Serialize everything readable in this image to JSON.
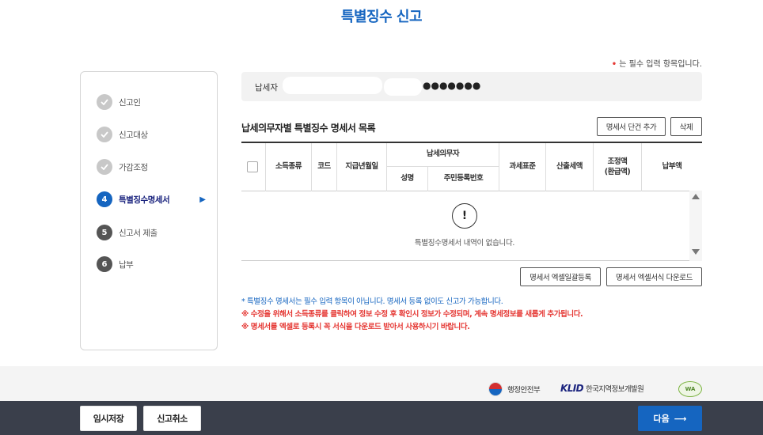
{
  "page": {
    "title": "특별징수 신고"
  },
  "required_note": {
    "marker": "•",
    "text": "는 필수 입력 항목입니다."
  },
  "steps": [
    {
      "label": "신고인",
      "status": "done",
      "number": ""
    },
    {
      "label": "신고대상",
      "status": "done",
      "number": ""
    },
    {
      "label": "가감조정",
      "status": "done",
      "number": ""
    },
    {
      "label": "특별징수명세서",
      "status": "active",
      "number": "4"
    },
    {
      "label": "신고서 제출",
      "status": "todo",
      "number": "5"
    },
    {
      "label": "납부",
      "status": "todo",
      "number": "6"
    }
  ],
  "taxpayer": {
    "label": "납세자",
    "masked_suffix": "●●●●●●●"
  },
  "list": {
    "title": "납세의무자별 특별징수 명세서 목록",
    "add_button": "명세서 단건 추가",
    "delete_button": "삭제",
    "columns": {
      "income_type": "소득종류",
      "code": "코드",
      "pay_month": "지급년월일",
      "taxpayer_group": "납세의무자",
      "name": "성명",
      "rrn": "주민등록번호",
      "tax_base": "과세표준",
      "calculated_tax": "산출세액",
      "adjustment": "조정액\n(환급액)",
      "payable": "납부액"
    },
    "empty_message": "특별징수명세서 내역이 없습니다.",
    "excel_upload_button": "명세서 엑셀일괄등록",
    "excel_download_button": "명세서 엑셀서식 다운로드"
  },
  "notes": {
    "note1": "* 특별징수 명세서는 필수 입력 항목이 아닙니다. 명세서 등록 없이도 신고가 가능합니다.",
    "note2": "※ 수정을 위해서 소득종류를 클릭하여 정보 수정 후 확인시 정보가 수정되며, 계속 명세정보를 새롭게 추가됩니다.",
    "note3": "※ 명세서를 엑셀로 등록시 꼭 서식을 다운로드 받아서 사용하시기 바랍니다."
  },
  "logos": {
    "mois": "행정안전부",
    "klid_mark": "KLID",
    "klid_name": "한국지역정보개발원",
    "seal": "WA"
  },
  "actions": {
    "temp_save": "임시저장",
    "cancel": "신고취소",
    "next": "다음",
    "next_arrow": "⟶"
  },
  "colors": {
    "primary": "#1565c0",
    "danger": "#e53935",
    "footer_bar": "#3a3f4b"
  }
}
